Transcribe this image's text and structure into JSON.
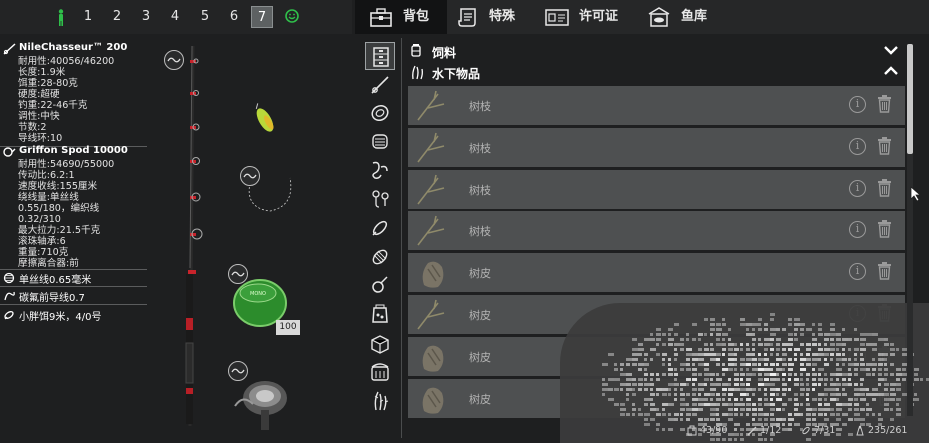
{
  "slots": {
    "numbers": [
      "1",
      "2",
      "3",
      "4",
      "5",
      "6",
      "7"
    ],
    "active": "7"
  },
  "rod": {
    "name": "NileChasseur™ 200",
    "durability_label": "耐用性:",
    "durability": "40056/46200",
    "length_label": "长度:",
    "length": "1.9米",
    "lure_label": "饵重:",
    "lure": "28-80克",
    "hardness_label": "硬度:",
    "hardness": "超硬",
    "lineweight_label": "钓重:",
    "lineweight": "22-46千克",
    "action_label": "调性:",
    "action": "中快",
    "sections_label": "节数:",
    "sections": "2",
    "guides_label": "导线环:",
    "guides": "10"
  },
  "reel": {
    "name": "Griffon Spod 10000",
    "durability_label": "耐用性:",
    "durability": "54690/55000",
    "ratio_label": "传动比:",
    "ratio": "6.2:1",
    "speed_label": "速度收线:",
    "speed": "155厘米",
    "capacity_label": "绕线量:",
    "capacity": "单丝线",
    "capacity2": "0.55/180，编织线",
    "capacity3": "0.32/310",
    "drag_label": "最大拉力:",
    "drag": "21.5千克",
    "bearings_label": "滚珠轴承:",
    "bearings": "6",
    "weight_label": "重量:",
    "weight": "710克",
    "clutch_label": "摩擦离合器:",
    "clutch": "前"
  },
  "tackle": {
    "line": "单丝线0.65毫米",
    "leader": "碳氟前导线0.7",
    "bait": "小胖饵9米，4/0号"
  },
  "center": {
    "spool_count": "100"
  },
  "tabs": [
    {
      "label": "背包",
      "icon": "backpack-icon"
    },
    {
      "label": "特殊",
      "icon": "scroll-icon"
    },
    {
      "label": "许可证",
      "icon": "license-icon"
    },
    {
      "label": "鱼库",
      "icon": "fish-storage-icon"
    }
  ],
  "categories": [
    "drawer-icon",
    "rod-icon",
    "reel-icon",
    "line-icon",
    "hook-icon",
    "float-icon",
    "lure-icon",
    "feeder-icon",
    "bobber-icon",
    "bait-bag-icon",
    "box-icon",
    "keepnet-icon",
    "plant-icon"
  ],
  "groups": {
    "feed": "饲料",
    "underwater": "水下物品"
  },
  "items": [
    {
      "name": "树枝",
      "icon": "branch-icon"
    },
    {
      "name": "树枝",
      "icon": "branch-icon"
    },
    {
      "name": "树枝",
      "icon": "branch-icon"
    },
    {
      "name": "树枝",
      "icon": "branch-icon"
    },
    {
      "name": "树皮",
      "icon": "bark-icon"
    },
    {
      "name": "树皮",
      "icon": "branch-icon"
    },
    {
      "name": "树皮",
      "icon": "bark-icon"
    },
    {
      "name": "树皮",
      "icon": "bark-icon"
    }
  ],
  "info_glyph": "i",
  "counters": {
    "bag": "43/90",
    "rods": "1/12",
    "lures": "7/31",
    "weight": "235/261"
  },
  "colors": {
    "panel_bg": "#1e1f20",
    "row_bg": "#4e5051",
    "active_slot": "#5d6162",
    "green_icon": "#2fbf4a"
  }
}
